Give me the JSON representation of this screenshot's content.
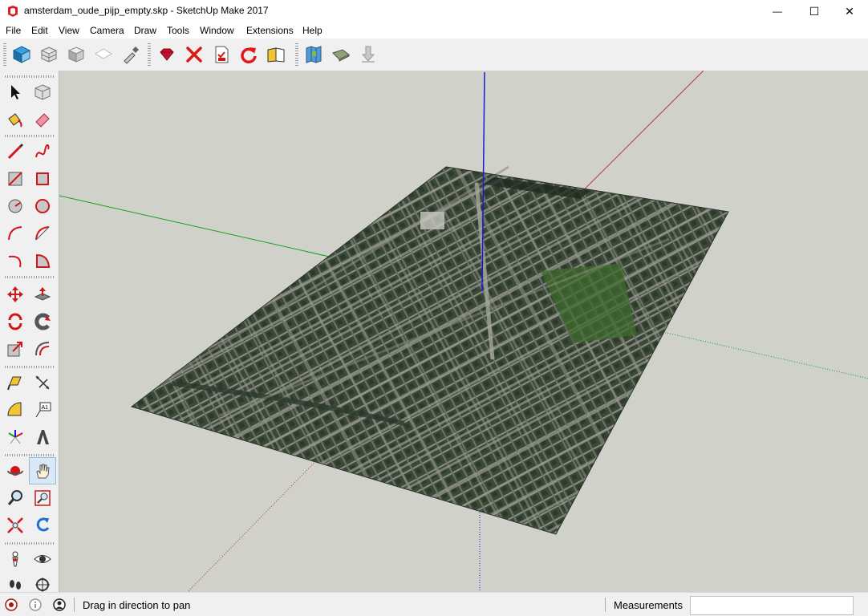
{
  "window": {
    "title": "amsterdam_oude_pijp_empty.skp - SketchUp Make 2017",
    "minimize_glyph": "—",
    "maximize_glyph": "☐",
    "close_glyph": "✕"
  },
  "menu": [
    "File",
    "Edit",
    "View",
    "Camera",
    "Draw",
    "Tools",
    "Window",
    "Extensions",
    "Help"
  ],
  "toolbar": {
    "groups": [
      [
        "iso-view-icon",
        "wireframe-style-icon",
        "shaded-style-icon",
        "hidden-line-style-icon",
        "eyedropper-icon"
      ],
      [
        "ruby-gem-icon",
        "delete-icon",
        "report-icon",
        "redo-icon",
        "open-book-icon"
      ],
      [
        "map-location-icon",
        "photo-textures-icon",
        "download-model-icon"
      ]
    ]
  },
  "tools": [
    [
      "select-icon",
      "make-component-icon"
    ],
    [
      "paint-bucket-icon",
      "eraser-icon"
    ],
    [
      "pencil-line-icon",
      "freehand-icon"
    ],
    [
      "rectangle-icon",
      "rotated-rectangle-icon"
    ],
    [
      "circle-icon",
      "polygon-icon"
    ],
    [
      "arc-icon",
      "two-point-arc-icon"
    ],
    [
      "three-point-arc-icon",
      "pie-icon"
    ],
    [
      "move-icon",
      "push-pull-icon"
    ],
    [
      "rotate-icon",
      "follow-me-icon"
    ],
    [
      "scale-icon",
      "offset-icon"
    ],
    [
      "tape-measure-icon",
      "dimension-icon"
    ],
    [
      "protractor-icon",
      "text-label-icon"
    ],
    [
      "axes-icon",
      "3d-text-icon"
    ],
    [
      "orbit-icon",
      "pan-hand-icon"
    ],
    [
      "zoom-icon",
      "zoom-window-icon"
    ],
    [
      "zoom-extents-icon",
      "previous-view-icon"
    ],
    [
      "position-camera-icon",
      "look-around-icon"
    ],
    [
      "walk-icon",
      "section-plane-icon"
    ]
  ],
  "status": {
    "message": "Drag in direction to pan",
    "measurements_label": "Measurements",
    "measurements_value": ""
  },
  "colors": {
    "viewport_bg": "#d1d1cc",
    "axis_red": "#c03030",
    "axis_green": "#18a018",
    "axis_blue": "#1a1ad0"
  }
}
